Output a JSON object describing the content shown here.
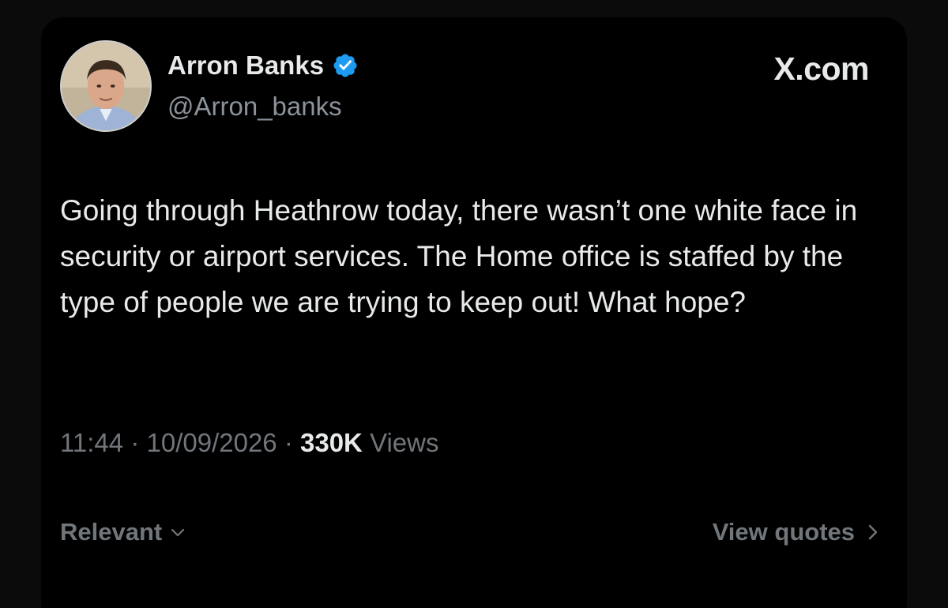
{
  "author": {
    "display_name": "Arron Banks",
    "handle": "@Arron_banks",
    "verified": true
  },
  "brand": "X.com",
  "tweet": {
    "text": "Going through Heathrow today, there wasn’t one white face in security or airport services. The Home office is staffed by the type of people we are trying to keep out! What hope?"
  },
  "meta": {
    "time": "11:44",
    "separator": "·",
    "date": "10/09/2026",
    "views_count": "330K",
    "views_label": "Views"
  },
  "footer": {
    "sort_label": "Relevant",
    "view_quotes_label": "View quotes"
  },
  "icons": {
    "verified": "verified-badge-icon",
    "sort_chevron": "chevron-down-icon",
    "quotes_chevron": "chevron-right-icon"
  },
  "colors": {
    "background": "#000000",
    "text_primary": "#e7e9ea",
    "text_secondary": "#71767b",
    "verified_blue": "#1d9bf0"
  }
}
